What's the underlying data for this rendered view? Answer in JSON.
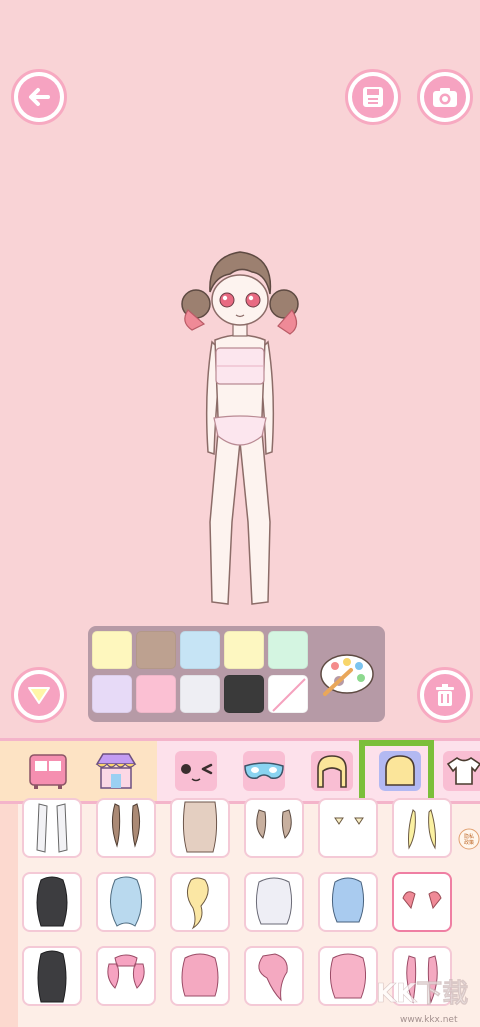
{
  "buttons": {
    "back": "arrow-left-icon",
    "save": "floppy-disk-icon",
    "camera": "camera-icon",
    "collapse": "triangle-down-icon",
    "trash": "trash-icon"
  },
  "palette": {
    "colors": [
      "#fef7be",
      "#bda190",
      "#c6e4f5",
      "#fdf7c1",
      "#d4f5e1",
      "#e7daf7",
      "#fbc0d3",
      "#eeeef3",
      "#3a3a3a",
      "none"
    ],
    "tool_icon": "paint-palette-icon"
  },
  "toolbar": {
    "items": [
      "wardrobe-icon",
      "shop-icon",
      "face-icon",
      "mask-icon",
      "hair-front-icon",
      "hair-back-icon",
      "shirt-icon"
    ],
    "selected": "hair-back-icon",
    "highlight_color": "#7bbf3a"
  },
  "items_grid": {
    "rows": 3,
    "selected_item": "pink-side-tails"
  },
  "badge": {
    "text": "隐私\n政策"
  },
  "watermark": {
    "text": "KK下载",
    "url_text": "www.kkx.net"
  }
}
